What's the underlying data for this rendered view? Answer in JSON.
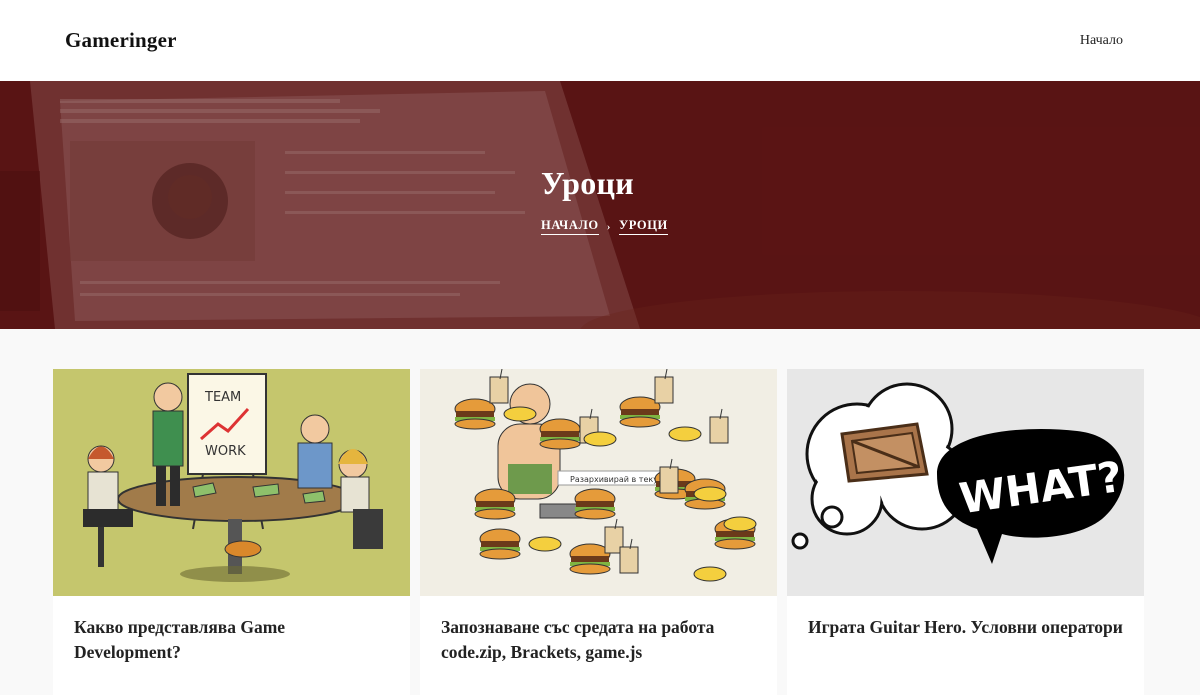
{
  "header": {
    "brand": "Gameringer",
    "nav": [
      "Начало"
    ]
  },
  "hero": {
    "title": "Уроци",
    "breadcrumb": [
      "НАЧАЛО",
      "УРОЦИ"
    ]
  },
  "posts": [
    {
      "title": "Какво представлява Game Development?",
      "image": "team-work-meeting-illustration",
      "image_text": [
        "TEAM",
        "WORK"
      ]
    },
    {
      "title": "Запознаване със средата на работа code.zip, Brackets, game.js",
      "image": "burgers-fries-shakes-character-illustration",
      "image_text": "Разархивирай в текущ"
    },
    {
      "title": "Играта Guitar Hero. Условни оператори",
      "image": "wooden-crate-thought-bubble-illustration",
      "image_text": "WHAT?"
    }
  ],
  "colors": {
    "hero_overlay": "#5a1212",
    "card_bg": "#ffffff",
    "page_bg": "#f9f9f9"
  }
}
